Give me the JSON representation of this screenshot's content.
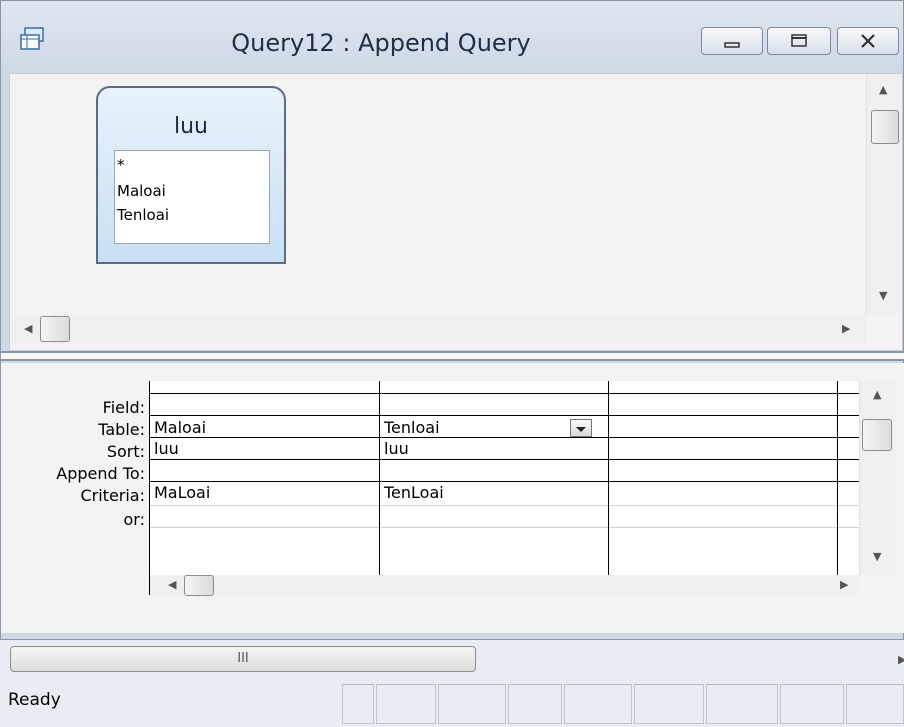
{
  "window": {
    "title": "Query12 : Append Query"
  },
  "table": {
    "name": "luu",
    "fields": [
      "*",
      "Maloai",
      "Tenloai"
    ]
  },
  "grid": {
    "row_labels": [
      "Field:",
      "Table:",
      "Sort:",
      "Append To:",
      "Criteria:",
      "or:"
    ],
    "columns": [
      {
        "field": "Maloai",
        "table": "luu",
        "sort": "",
        "append_to": "MaLoai",
        "criteria": "",
        "or": ""
      },
      {
        "field": "Tenloai",
        "table": "luu",
        "sort": "",
        "append_to": "TenLoai",
        "criteria": "",
        "or": ""
      },
      {
        "field": "",
        "table": "",
        "sort": "",
        "append_to": "",
        "criteria": "",
        "or": ""
      }
    ]
  },
  "scroll": {
    "thumb_glyph": "III"
  },
  "status": {
    "text": "Ready"
  }
}
